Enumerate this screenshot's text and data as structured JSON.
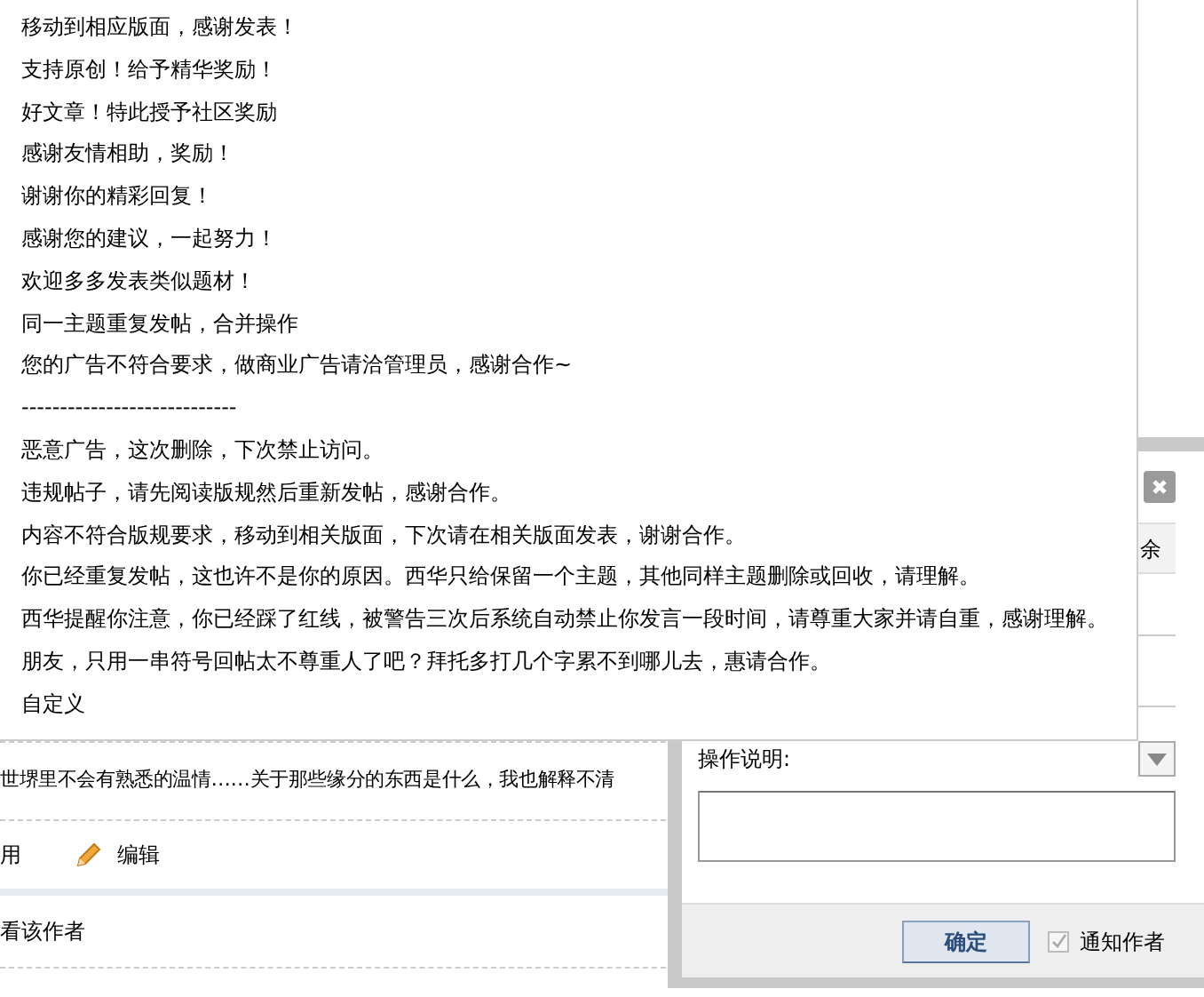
{
  "options": [
    "移动到相应版面，感谢发表！",
    "支持原创！给予精华奖励！",
    "好文章！特此授予社区奖励",
    "感谢友情相助，奖励！",
    "谢谢你的精彩回复！",
    "感谢您的建议，一起努力！",
    "欢迎多多发表类似题材！",
    "同一主题重复发帖，合并操作",
    "您的广告不符合要求，做商业广告请洽管理员，感谢合作~",
    "----------------------------",
    "恶意广告，这次删除，下次禁止访问。",
    "违规帖子，请先阅读版规然后重新发帖，感谢合作。",
    "内容不符合版规要求，移动到相关版面，下次请在相关版面发表，谢谢合作。",
    "你已经重复发帖，这也许不是你的原因。西华只给保留一个主题，其他同样主题删除或回收，请理解。",
    "西华提醒你注意，你已经踩了红线，被警告三次后系统自动禁止你发言一段时间，请尊重大家并请自重，感谢理解。",
    "朋友，只用一串符号回帖太不尊重人了吧？拜托多打几个字累不到哪儿去，惠请合作。",
    "自定义"
  ],
  "page": {
    "post_text": "世堺里不会有熟悉的温情……关于那些缘分的东西是什么，我也解释不清",
    "actions": [
      "用",
      "编辑"
    ],
    "view_author": "看该作者"
  },
  "dialog": {
    "tab_fragment": "余",
    "label": "操作说明:",
    "button": "确定",
    "notify": {
      "label": "通知作者",
      "checked": true
    }
  }
}
